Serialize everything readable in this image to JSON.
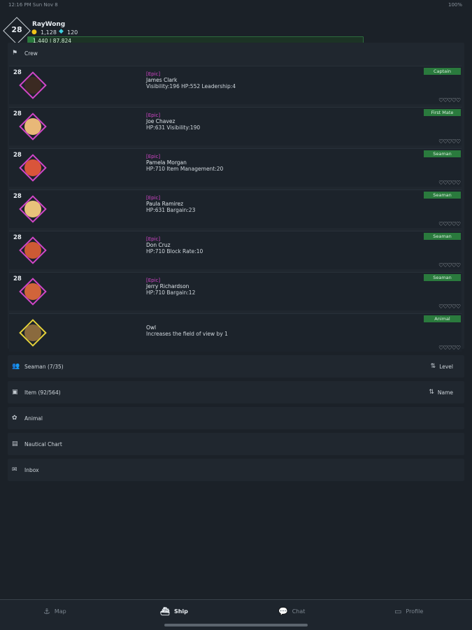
{
  "status": {
    "time": "12:16 PM  Sun Nov 8",
    "right": "100%"
  },
  "header": {
    "level": "28",
    "username": "RayWong",
    "gold": "1,128",
    "gems": "120",
    "xp_text": "1,440 | 87,824",
    "xp_fraction": 0.02
  },
  "crew_section": {
    "title": "Crew",
    "icon": "flag-icon"
  },
  "crew": [
    {
      "level": "28",
      "rarity": "[Epic]",
      "name": "James Clark",
      "stats": "Visibility:196  HP:552  Leadership:4",
      "role": "Captain",
      "face": "#3b2a22",
      "frame": "pink"
    },
    {
      "level": "28",
      "rarity": "[Epic]",
      "name": "Joe Chavez",
      "stats": "HP:631  Visibility:190",
      "role": "First Mate",
      "face": "#e8b878",
      "frame": "pink"
    },
    {
      "level": "28",
      "rarity": "[Epic]",
      "name": "Pamela Morgan",
      "stats": "HP:710  Item Management:20",
      "role": "Seaman",
      "face": "#d9553a",
      "frame": "pink"
    },
    {
      "level": "28",
      "rarity": "[Epic]",
      "name": "Paula Ramirez",
      "stats": "HP:631  Bargain:23",
      "role": "Seaman",
      "face": "#e8c27a",
      "frame": "pink"
    },
    {
      "level": "28",
      "rarity": "[Epic]",
      "name": "Don Cruz",
      "stats": "HP:710  Block Rate:10",
      "role": "Seaman",
      "face": "#cc5a34",
      "frame": "pink"
    },
    {
      "level": "28",
      "rarity": "[Epic]",
      "name": "Jerry Richardson",
      "stats": "HP:710  Bargain:12",
      "role": "Seaman",
      "face": "#d1643a",
      "frame": "pink"
    },
    {
      "level": "",
      "rarity": "",
      "name": "Owl",
      "stats": "Increases the field of view by 1",
      "role": "Animal",
      "face": "#8a6a3e",
      "frame": "yellow"
    }
  ],
  "hearts": "♡♡♡♡♡",
  "sections": {
    "seaman": {
      "title": "Seaman (7/35)",
      "sort": "Level"
    },
    "item": {
      "title": "Item (92/564)",
      "sort": "Name"
    },
    "animal": {
      "title": "Animal"
    },
    "chart": {
      "title": "Nautical Chart"
    },
    "inbox": {
      "title": "Inbox"
    }
  },
  "tabs": {
    "map": "Map",
    "ship": "Ship",
    "chat": "Chat",
    "profile": "Profile"
  },
  "colors": {
    "accent_green": "#2a7a3d",
    "epic": "#d246c8",
    "animal_frame": "#e6d23a"
  }
}
